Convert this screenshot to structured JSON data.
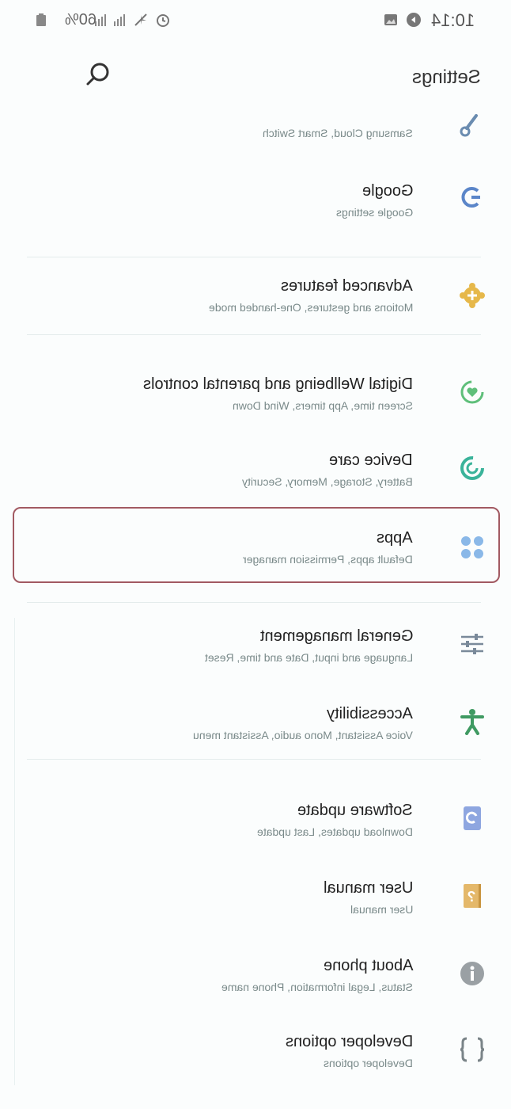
{
  "status_bar": {
    "time": "10:14",
    "battery": "60%"
  },
  "header": {
    "title": "Settings"
  },
  "items": [
    {
      "title": "",
      "subtitle": "Samsung Cloud, Smart Switch",
      "icon": "key-icon",
      "color": "#6a8cb0"
    },
    {
      "title": "Google",
      "subtitle": "Google settings",
      "icon": "google-icon",
      "color": "#5b86c9"
    },
    {
      "title": "Advanced features",
      "subtitle": "Motions and gestures, One-handed mode",
      "icon": "puzzle-gear-icon",
      "color": "#e6b84a"
    },
    {
      "title": "Digital Wellbeing and parental controls",
      "subtitle": "Screen time, App timers, Wind Down",
      "icon": "wellbeing-icon",
      "color": "#5fbf7a"
    },
    {
      "title": "Device care",
      "subtitle": "Battery, Storage, Memory, Security",
      "icon": "device-care-icon",
      "color": "#3ab39a"
    },
    {
      "title": "Apps",
      "subtitle": "Default apps, Permission manager",
      "icon": "apps-icon",
      "color": "#8ab8e8"
    },
    {
      "title": "General management",
      "subtitle": "Language and input, Date and time, Reset",
      "icon": "sliders-icon",
      "color": "#7a8a9a"
    },
    {
      "title": "Accessibility",
      "subtitle": "Voice Assistant, Mono audio, Assistant menu",
      "icon": "accessibility-icon",
      "color": "#3f9a62"
    },
    {
      "title": "Software update",
      "subtitle": "Download updates, Last update",
      "icon": "software-update-icon",
      "color": "#8ea6e0"
    },
    {
      "title": "User manual",
      "subtitle": "User manual",
      "icon": "user-manual-icon",
      "color": "#e4b86a"
    },
    {
      "title": "About phone",
      "subtitle": "Status, Legal information, Phone name",
      "icon": "info-icon",
      "color": "#9aa0a4"
    },
    {
      "title": "Developer options",
      "subtitle": "Developer options",
      "icon": "braces-icon",
      "color": "#7a8488"
    }
  ]
}
